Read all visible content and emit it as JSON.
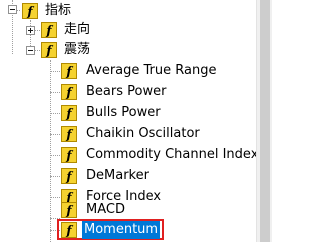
{
  "tree": {
    "root": {
      "label": "指标",
      "expanded": true,
      "icon": "function-icon"
    },
    "trend": {
      "label": "走向",
      "expanded": false,
      "icon": "function-icon"
    },
    "oscillators": {
      "label": "震荡",
      "expanded": true,
      "icon": "function-icon",
      "items": [
        {
          "label": "Average True Range",
          "icon": "function-icon"
        },
        {
          "label": "Bears Power",
          "icon": "function-icon"
        },
        {
          "label": "Bulls Power",
          "icon": "function-icon"
        },
        {
          "label": "Chaikin Oscillator",
          "icon": "function-icon"
        },
        {
          "label": "Commodity Channel Index",
          "icon": "function-icon"
        },
        {
          "label": "DeMarker",
          "icon": "function-icon"
        },
        {
          "label": "Force Index",
          "icon": "function-icon"
        },
        {
          "label": "MACD",
          "icon": "function-icon"
        },
        {
          "label": "Momentum",
          "icon": "function-icon",
          "selected": true
        }
      ]
    }
  },
  "colors": {
    "icon_fill": "#f5d230",
    "icon_border": "#b08a00",
    "selection": "#0078d7",
    "highlight_frame": "#e02020"
  }
}
